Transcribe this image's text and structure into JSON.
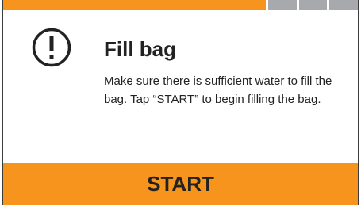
{
  "progress": {
    "completed_fraction": 0.74,
    "remaining_segments": 3,
    "fill_color": "#f7941d",
    "segment_color": "#a7a9ac"
  },
  "dialog": {
    "icon": "alert-circle-icon",
    "title": "Fill bag",
    "message": "Make sure there is sufficient water to fill the bag. Tap “START” to begin filling the bag."
  },
  "start_button": {
    "label": "START",
    "color": "#f7941d"
  },
  "colors": {
    "border": "#3c3c3c",
    "text": "#222222"
  }
}
